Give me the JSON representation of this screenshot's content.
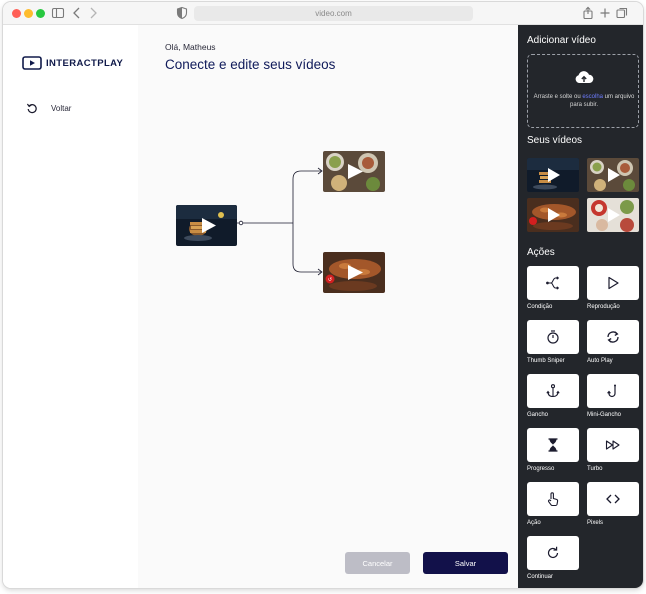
{
  "browser": {
    "url": "video.com"
  },
  "sidebar": {
    "logo_text": "INTERACTPLAY",
    "back_label": "Voltar"
  },
  "main": {
    "greeting": "Olá, Matheus",
    "title": "Conecte e edite seus vídeos",
    "cancel_label": "Cancelar",
    "save_label": "Salvar"
  },
  "panel": {
    "upload_title": "Adicionar vídeo",
    "upload_text_before": "Arraste e solte ou ",
    "upload_link": "escolha",
    "upload_text_after": " um arquivo para subir.",
    "videos_title": "Seus vídeos",
    "actions_title": "Ações",
    "actions": [
      {
        "label": "Condição",
        "icon": "condition-icon"
      },
      {
        "label": "Reprodução",
        "icon": "play-outline-icon"
      },
      {
        "label": "Thumb Sniper",
        "icon": "stopwatch-icon"
      },
      {
        "label": "Auto Play",
        "icon": "repeat-icon"
      },
      {
        "label": "Gancho",
        "icon": "anchor-icon"
      },
      {
        "label": "Mini-Gancho",
        "icon": "hook-icon"
      },
      {
        "label": "Progresso",
        "icon": "hourglass-icon"
      },
      {
        "label": "Turbo",
        "icon": "fast-forward-icon"
      },
      {
        "label": "Ação",
        "icon": "tap-icon"
      },
      {
        "label": "Pixels",
        "icon": "code-icon"
      },
      {
        "label": "Continuar",
        "icon": "redo-icon"
      }
    ]
  },
  "colors": {
    "brand_navy": "#12114a",
    "title_blue": "#0f1a5a",
    "panel_bg": "#23262b",
    "link": "#6d7cff",
    "cancel_disabled": "#bdbdc6"
  }
}
